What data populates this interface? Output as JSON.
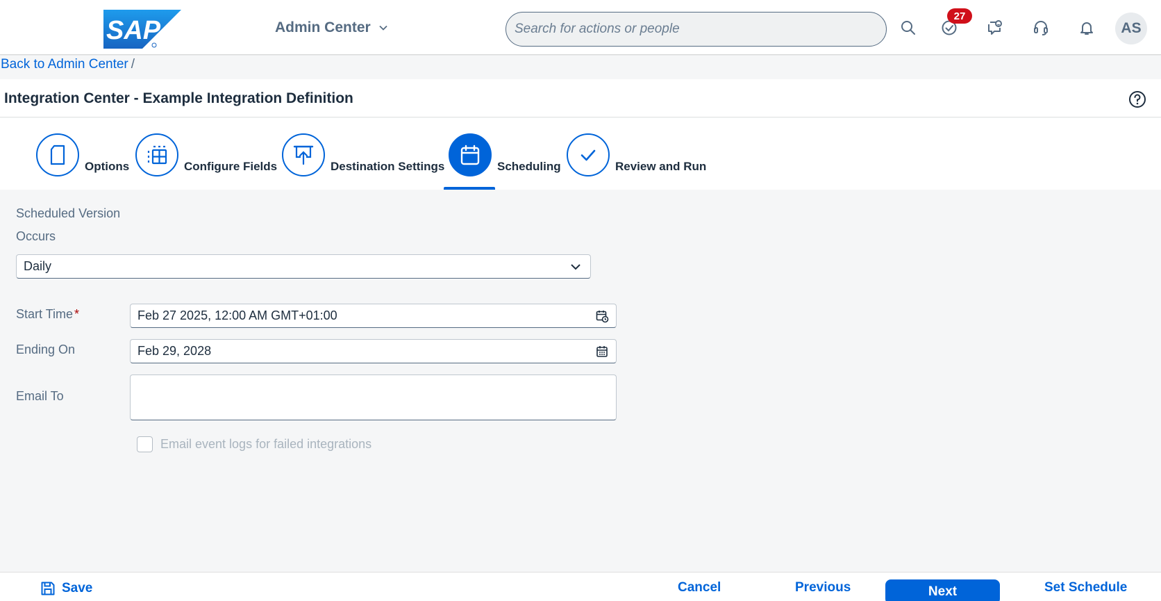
{
  "shell": {
    "logo_text": "SAP",
    "app_title": "Admin Center",
    "search_placeholder": "Search for actions or people",
    "notification_count": "27",
    "avatar_initials": "AS"
  },
  "breadcrumb": {
    "back_link": "Back to Admin Center",
    "separator": "/"
  },
  "page": {
    "title": "Integration Center - Example Integration Definition"
  },
  "wizard": {
    "steps": [
      {
        "label": "Options",
        "icon": "document-icon"
      },
      {
        "label": "Configure Fields",
        "icon": "table-icon"
      },
      {
        "label": "Destination Settings",
        "icon": "upload-presentation-icon"
      },
      {
        "label": "Scheduling",
        "icon": "calendar-icon",
        "active": true
      },
      {
        "label": "Review and Run",
        "icon": "checkmark-icon"
      }
    ]
  },
  "form": {
    "scheduled_version_label": "Scheduled Version",
    "occurs_label": "Occurs",
    "occurs_value": "Daily",
    "start_time_label": "Start Time",
    "required_marker": "*",
    "start_time_value": "Feb 27 2025, 12:00 AM GMT+01:00",
    "ending_on_label": "Ending On",
    "ending_on_value": "Feb 29, 2028",
    "email_to_label": "Email To",
    "email_to_value": "",
    "email_logs_label": "Email event logs for failed integrations"
  },
  "footer": {
    "save": "Save",
    "cancel": "Cancel",
    "previous": "Previous",
    "next": "Next",
    "set_schedule": "Set Schedule"
  },
  "colors": {
    "accent": "#0064d9",
    "badge": "#d0101a",
    "text": "#1d2d3e",
    "muted": "#556b82"
  }
}
